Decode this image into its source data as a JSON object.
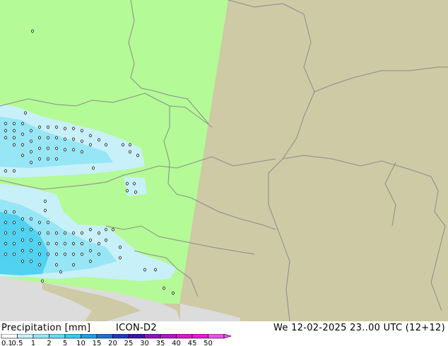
{
  "legend": {
    "title": "Precipitation [mm]",
    "model": "ICON-D2",
    "datetime": "We 12-02-2025 23..00 UTC (12+12)"
  },
  "scale": {
    "labels": [
      "0.1",
      "0.5",
      "1",
      "2",
      "5",
      "10",
      "15",
      "20",
      "25",
      "30",
      "35",
      "40",
      "45",
      "50"
    ],
    "colors": [
      "#ffffff",
      "#c8f0f8",
      "#96e6f6",
      "#64dcf4",
      "#32cdf0",
      "#1ea0e6",
      "#1e6ed2",
      "#1e3cbe",
      "#3c14aa",
      "#8c14be",
      "#b414c8",
      "#dc14d2",
      "#f014dc",
      "#f050e6"
    ]
  },
  "map": {
    "colors": {
      "land_in_domain": "#b4fa96",
      "land_out_domain": "#cdcaa5",
      "sea": "#dcdcdc",
      "border": "#8c8c8c",
      "precip_light": "#c8f0f8",
      "precip_medium": "#96e6f6",
      "precip_heavy": "#50d2f0"
    }
  }
}
